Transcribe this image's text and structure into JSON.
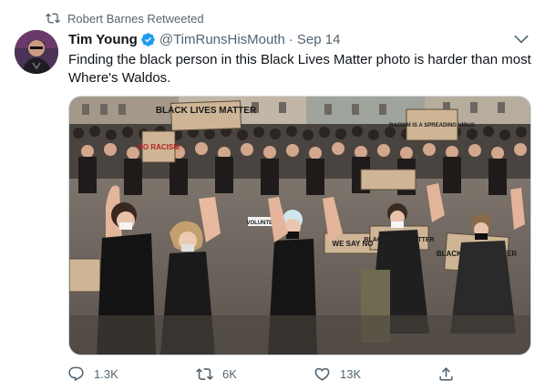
{
  "retweet_context": {
    "text": "Robert Barnes Retweeted",
    "icon": "retweet-icon"
  },
  "tweet": {
    "author_name": "Tim Young",
    "verified": true,
    "handle": "@TimRunsHisMouth",
    "separator": "·",
    "date": "Sep 14",
    "text": "Finding the black person in this Black Lives Matter photo is harder than most Where's Waldos.",
    "media": {
      "signs": [
        "BLACK LIVES MATTER",
        "NO RACISM",
        "RACISM IS A SPREADING VIRUS",
        "VOLUNTEER",
        "BLACK LIVES MATTER",
        "WE SAY NO",
        "BLACK LIVES MATTER"
      ]
    }
  },
  "actions": {
    "reply": {
      "count": "1.3K",
      "icon": "reply-icon"
    },
    "retweet": {
      "count": "6K",
      "icon": "retweet-icon"
    },
    "like": {
      "count": "13K",
      "icon": "heart-icon"
    },
    "share": {
      "icon": "share-icon"
    }
  },
  "colors": {
    "accent": "#1d9bf0",
    "secondary_text": "#536471",
    "primary_text": "#0f1419",
    "border": "#cfd9de"
  }
}
